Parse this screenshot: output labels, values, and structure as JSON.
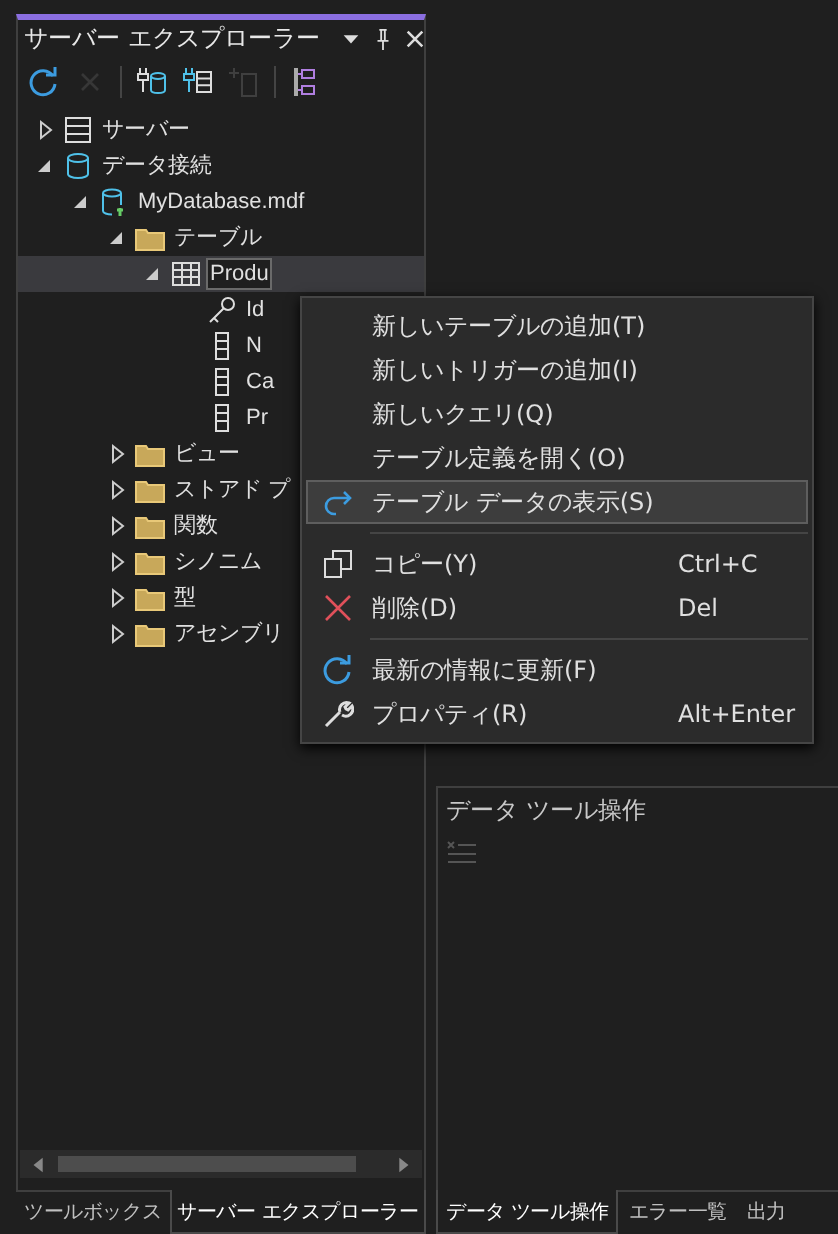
{
  "explorer": {
    "title": "サーバー エクスプローラー",
    "toolbar": [
      {
        "kind": "refresh",
        "disabled": false
      },
      {
        "kind": "stop",
        "disabled": true
      },
      {
        "kind": "connect-db",
        "disabled": false
      },
      {
        "kind": "connect-server",
        "disabled": false
      },
      {
        "kind": "new",
        "disabled": true
      },
      {
        "kind": "diagram",
        "disabled": false
      }
    ],
    "tree": [
      {
        "label": "サーバー",
        "kind": "server",
        "expanded": false,
        "selected": false
      },
      {
        "label": "データ接続",
        "kind": "connection",
        "expanded": true,
        "selected": false,
        "children": [
          {
            "label": "MyDatabase.mdf",
            "kind": "database",
            "expanded": true,
            "selected": false,
            "children": [
              {
                "label": "テーブル",
                "kind": "folder",
                "expanded": true,
                "selected": false,
                "children": [
                  {
                    "label": "Produ",
                    "kind": "table",
                    "expanded": true,
                    "selected": true,
                    "children": [
                      {
                        "label": "Id",
                        "kind": "key",
                        "selected": false
                      },
                      {
                        "label": "N",
                        "kind": "column",
                        "selected": false
                      },
                      {
                        "label": "Ca",
                        "kind": "column",
                        "selected": false
                      },
                      {
                        "label": "Pr",
                        "kind": "column",
                        "selected": false
                      }
                    ]
                  }
                ]
              },
              {
                "label": "ビュー",
                "kind": "folder",
                "expanded": false,
                "selected": false
              },
              {
                "label": "ストアド プ",
                "kind": "folder",
                "expanded": false,
                "selected": false
              },
              {
                "label": "関数",
                "kind": "folder",
                "expanded": false,
                "selected": false
              },
              {
                "label": "シノニム",
                "kind": "folder",
                "expanded": false,
                "selected": false
              },
              {
                "label": "型",
                "kind": "folder",
                "expanded": false,
                "selected": false
              },
              {
                "label": "アセンブリ",
                "kind": "folder",
                "expanded": false,
                "selected": false
              }
            ]
          }
        ]
      }
    ],
    "tabs": [
      {
        "label": "ツールボックス",
        "selected": false
      },
      {
        "label": "サーバー エクスプローラー",
        "selected": true
      }
    ]
  },
  "context_menu": [
    {
      "kind": "item",
      "label": "新しいテーブルの追加(T)",
      "selected": false
    },
    {
      "kind": "item",
      "label": "新しいトリガーの追加(I)",
      "selected": false
    },
    {
      "kind": "item",
      "label": "新しいクエリ(Q)",
      "selected": false
    },
    {
      "kind": "item",
      "label": "テーブル定義を開く(O)",
      "selected": false
    },
    {
      "kind": "item",
      "label": "テーブル データの表示(S)",
      "selected": true
    },
    {
      "kind": "separator"
    },
    {
      "kind": "item",
      "label": "コピー(Y)",
      "shortcut": "Ctrl+C",
      "selected": false
    },
    {
      "kind": "item",
      "label": "削除(D)",
      "shortcut": "Del",
      "selected": false
    },
    {
      "kind": "separator"
    },
    {
      "kind": "item",
      "label": "最新の情報に更新(F)",
      "selected": false
    },
    {
      "kind": "item",
      "label": "プロパティ(R)",
      "shortcut": "Alt+Enter",
      "selected": false
    }
  ],
  "tool_panel": {
    "title": "データ ツール操作",
    "tabs": [
      {
        "label": "データ ツール操作",
        "selected": true
      },
      {
        "label": "エラー一覧",
        "selected": false
      },
      {
        "label": "出力",
        "selected": false
      }
    ]
  }
}
